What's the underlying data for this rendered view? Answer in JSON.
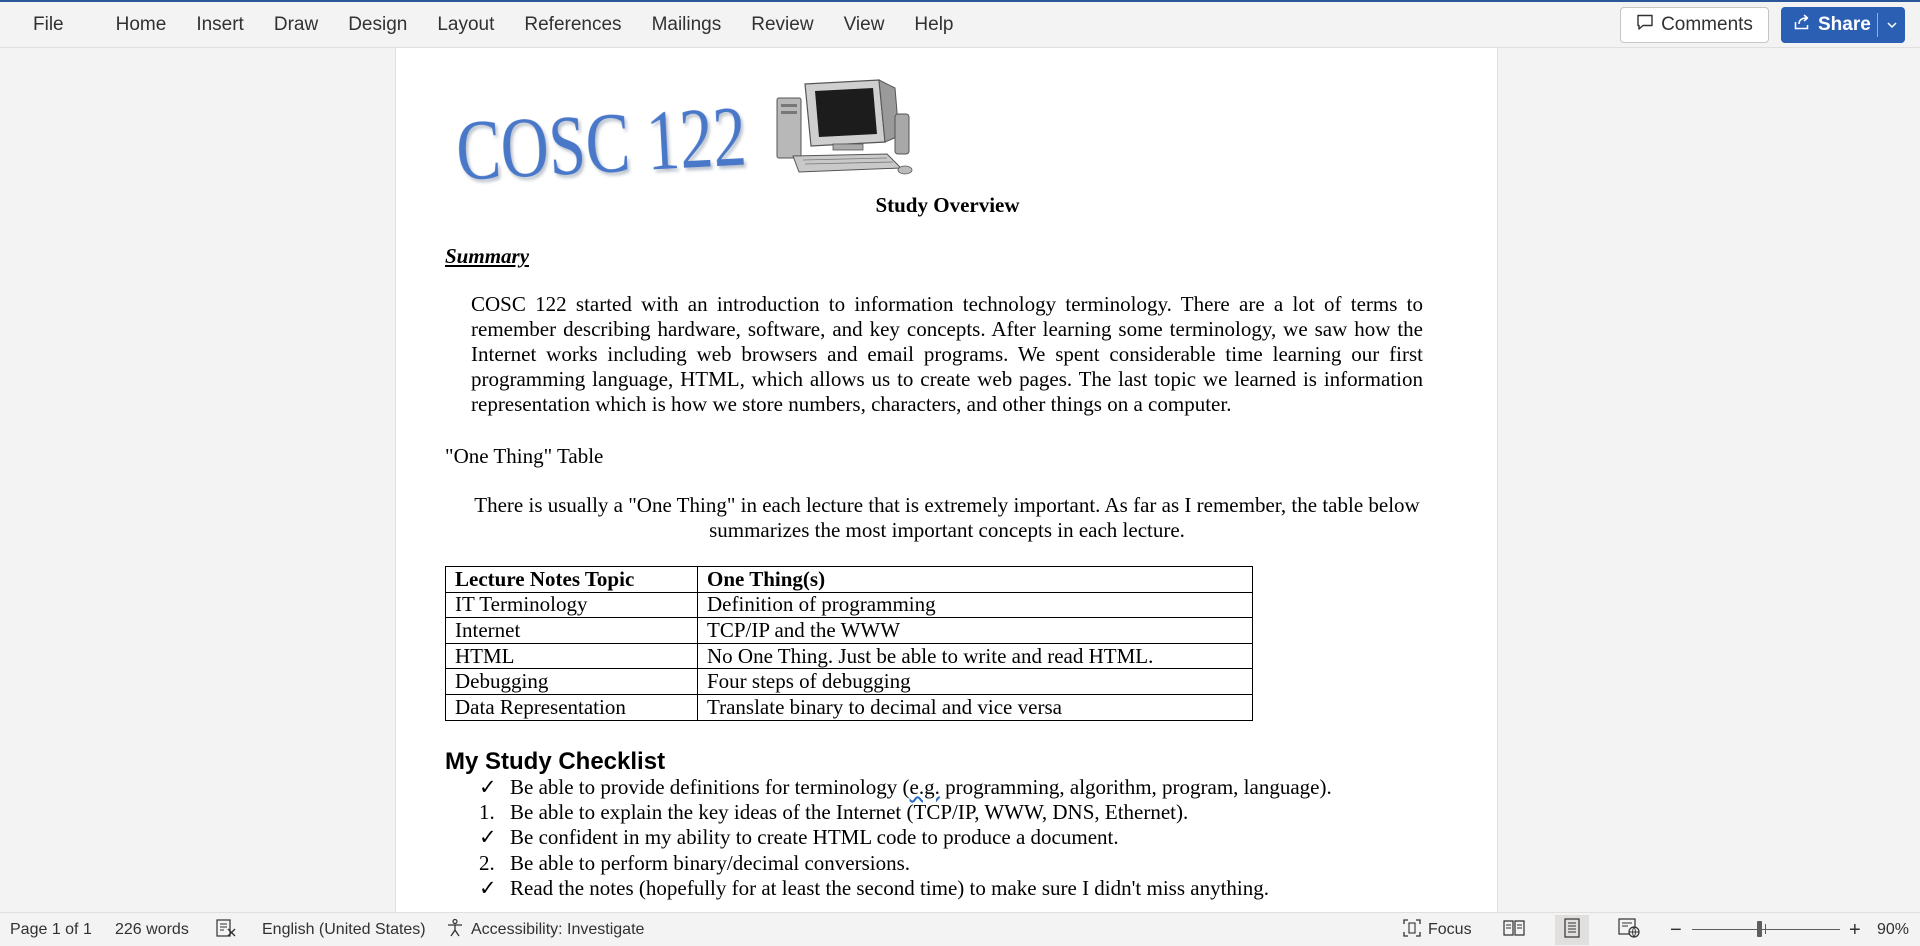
{
  "ribbon": {
    "tabs": [
      "File",
      "Home",
      "Insert",
      "Draw",
      "Design",
      "Layout",
      "References",
      "Mailings",
      "Review",
      "View",
      "Help"
    ],
    "comments_label": "Comments",
    "share_label": "Share",
    "accent_color": "#2b5fb4"
  },
  "document": {
    "logo_text": "COSC 122",
    "title": "Study Overview",
    "summary_heading": "Summary",
    "summary_body": "COSC 122 started with an introduction to information technology terminology.  There are a lot of terms to remember describing hardware, software, and key concepts.  After learning some terminology, we saw how the Internet works including web browsers and email programs.  We spent considerable time learning our first programming language, HTML, which allows us to create web pages.  The last topic we learned is information representation which is how we store numbers, characters, and other things on a computer.",
    "table_heading": "\"One Thing\" Table",
    "table_intro": "There is usually a \"One Thing\" in each lecture that is extremely important.  As far as I remember, the table below summarizes the most important concepts in each lecture.",
    "table": {
      "headers": [
        "Lecture Notes Topic",
        "One Thing(s)"
      ],
      "rows": [
        [
          "IT Terminology",
          "Definition of programming"
        ],
        [
          "Internet",
          "TCP/IP and the WWW"
        ],
        [
          "HTML",
          "No One Thing. Just be able to write and read HTML."
        ],
        [
          "Debugging",
          "Four steps of debugging"
        ],
        [
          "Data Representation",
          "Translate binary to decimal and vice versa"
        ]
      ]
    },
    "checklist_heading": "My Study Checklist",
    "checklist": [
      {
        "marker": "✓",
        "before": "Be able to provide definitions for terminology (",
        "flagged": "e.g.",
        "after": " programming, algorithm, program, language)."
      },
      {
        "marker": "1.",
        "before": "Be able to explain the key ideas of the Internet (TCP/IP, WWW, DNS, Ethernet).",
        "flagged": "",
        "after": ""
      },
      {
        "marker": "✓",
        "before": "Be confident in my ability to create HTML code to produce a document.",
        "flagged": "",
        "after": ""
      },
      {
        "marker": "2.",
        "before": "Be able to perform binary/decimal conversions.",
        "flagged": "",
        "after": ""
      },
      {
        "marker": "✓",
        "before": "Read the notes (hopefully for at least the second time) to make sure I didn't miss anything.",
        "flagged": "",
        "after": ""
      }
    ]
  },
  "status": {
    "page": "Page 1 of 1",
    "words": "226 words",
    "language": "English (United States)",
    "accessibility": "Accessibility: Investigate",
    "focus": "Focus",
    "zoom_minus": "−",
    "zoom_plus": "+",
    "zoom": "90%",
    "zoom_level_percent": 90
  },
  "icons": {
    "comments": "comment-icon",
    "share": "share-icon",
    "proofing": "proofing-icon",
    "accessibility": "accessibility-icon",
    "focus": "focus-icon",
    "read_mode": "read-mode-icon",
    "print_layout": "print-layout-icon",
    "web_layout": "web-layout-icon"
  }
}
